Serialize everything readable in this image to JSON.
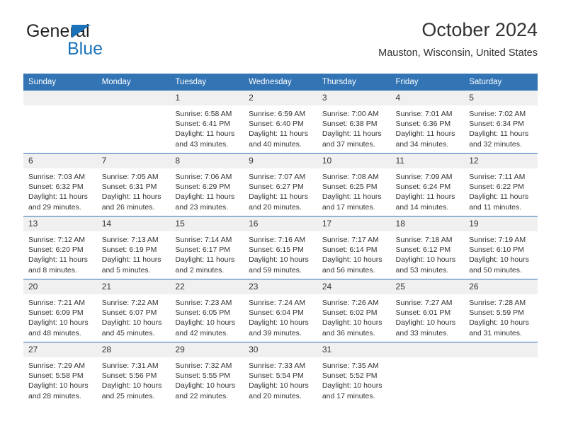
{
  "logo": {
    "word_one": "General",
    "word_two": "Blue",
    "triangle_icon": "triangle-icon",
    "brand_color": "#1b72b8",
    "text_color": "#231f20"
  },
  "header": {
    "title": "October 2024",
    "location": "Mauston, Wisconsin, United States"
  },
  "theme": {
    "header_blue": "#3274b4",
    "daynum_band": "#f0f0f0",
    "text": "#333333"
  },
  "calendar": {
    "weekday_headers": [
      "Sunday",
      "Monday",
      "Tuesday",
      "Wednesday",
      "Thursday",
      "Friday",
      "Saturday"
    ],
    "weeks": [
      [
        {
          "day": "",
          "lines": []
        },
        {
          "day": "",
          "lines": []
        },
        {
          "day": "1",
          "lines": [
            "Sunrise: 6:58 AM",
            "Sunset: 6:41 PM",
            "Daylight: 11 hours",
            "and 43 minutes."
          ]
        },
        {
          "day": "2",
          "lines": [
            "Sunrise: 6:59 AM",
            "Sunset: 6:40 PM",
            "Daylight: 11 hours",
            "and 40 minutes."
          ]
        },
        {
          "day": "3",
          "lines": [
            "Sunrise: 7:00 AM",
            "Sunset: 6:38 PM",
            "Daylight: 11 hours",
            "and 37 minutes."
          ]
        },
        {
          "day": "4",
          "lines": [
            "Sunrise: 7:01 AM",
            "Sunset: 6:36 PM",
            "Daylight: 11 hours",
            "and 34 minutes."
          ]
        },
        {
          "day": "5",
          "lines": [
            "Sunrise: 7:02 AM",
            "Sunset: 6:34 PM",
            "Daylight: 11 hours",
            "and 32 minutes."
          ]
        }
      ],
      [
        {
          "day": "6",
          "lines": [
            "Sunrise: 7:03 AM",
            "Sunset: 6:32 PM",
            "Daylight: 11 hours",
            "and 29 minutes."
          ]
        },
        {
          "day": "7",
          "lines": [
            "Sunrise: 7:05 AM",
            "Sunset: 6:31 PM",
            "Daylight: 11 hours",
            "and 26 minutes."
          ]
        },
        {
          "day": "8",
          "lines": [
            "Sunrise: 7:06 AM",
            "Sunset: 6:29 PM",
            "Daylight: 11 hours",
            "and 23 minutes."
          ]
        },
        {
          "day": "9",
          "lines": [
            "Sunrise: 7:07 AM",
            "Sunset: 6:27 PM",
            "Daylight: 11 hours",
            "and 20 minutes."
          ]
        },
        {
          "day": "10",
          "lines": [
            "Sunrise: 7:08 AM",
            "Sunset: 6:25 PM",
            "Daylight: 11 hours",
            "and 17 minutes."
          ]
        },
        {
          "day": "11",
          "lines": [
            "Sunrise: 7:09 AM",
            "Sunset: 6:24 PM",
            "Daylight: 11 hours",
            "and 14 minutes."
          ]
        },
        {
          "day": "12",
          "lines": [
            "Sunrise: 7:11 AM",
            "Sunset: 6:22 PM",
            "Daylight: 11 hours",
            "and 11 minutes."
          ]
        }
      ],
      [
        {
          "day": "13",
          "lines": [
            "Sunrise: 7:12 AM",
            "Sunset: 6:20 PM",
            "Daylight: 11 hours",
            "and 8 minutes."
          ]
        },
        {
          "day": "14",
          "lines": [
            "Sunrise: 7:13 AM",
            "Sunset: 6:19 PM",
            "Daylight: 11 hours",
            "and 5 minutes."
          ]
        },
        {
          "day": "15",
          "lines": [
            "Sunrise: 7:14 AM",
            "Sunset: 6:17 PM",
            "Daylight: 11 hours",
            "and 2 minutes."
          ]
        },
        {
          "day": "16",
          "lines": [
            "Sunrise: 7:16 AM",
            "Sunset: 6:15 PM",
            "Daylight: 10 hours",
            "and 59 minutes."
          ]
        },
        {
          "day": "17",
          "lines": [
            "Sunrise: 7:17 AM",
            "Sunset: 6:14 PM",
            "Daylight: 10 hours",
            "and 56 minutes."
          ]
        },
        {
          "day": "18",
          "lines": [
            "Sunrise: 7:18 AM",
            "Sunset: 6:12 PM",
            "Daylight: 10 hours",
            "and 53 minutes."
          ]
        },
        {
          "day": "19",
          "lines": [
            "Sunrise: 7:19 AM",
            "Sunset: 6:10 PM",
            "Daylight: 10 hours",
            "and 50 minutes."
          ]
        }
      ],
      [
        {
          "day": "20",
          "lines": [
            "Sunrise: 7:21 AM",
            "Sunset: 6:09 PM",
            "Daylight: 10 hours",
            "and 48 minutes."
          ]
        },
        {
          "day": "21",
          "lines": [
            "Sunrise: 7:22 AM",
            "Sunset: 6:07 PM",
            "Daylight: 10 hours",
            "and 45 minutes."
          ]
        },
        {
          "day": "22",
          "lines": [
            "Sunrise: 7:23 AM",
            "Sunset: 6:05 PM",
            "Daylight: 10 hours",
            "and 42 minutes."
          ]
        },
        {
          "day": "23",
          "lines": [
            "Sunrise: 7:24 AM",
            "Sunset: 6:04 PM",
            "Daylight: 10 hours",
            "and 39 minutes."
          ]
        },
        {
          "day": "24",
          "lines": [
            "Sunrise: 7:26 AM",
            "Sunset: 6:02 PM",
            "Daylight: 10 hours",
            "and 36 minutes."
          ]
        },
        {
          "day": "25",
          "lines": [
            "Sunrise: 7:27 AM",
            "Sunset: 6:01 PM",
            "Daylight: 10 hours",
            "and 33 minutes."
          ]
        },
        {
          "day": "26",
          "lines": [
            "Sunrise: 7:28 AM",
            "Sunset: 5:59 PM",
            "Daylight: 10 hours",
            "and 31 minutes."
          ]
        }
      ],
      [
        {
          "day": "27",
          "lines": [
            "Sunrise: 7:29 AM",
            "Sunset: 5:58 PM",
            "Daylight: 10 hours",
            "and 28 minutes."
          ]
        },
        {
          "day": "28",
          "lines": [
            "Sunrise: 7:31 AM",
            "Sunset: 5:56 PM",
            "Daylight: 10 hours",
            "and 25 minutes."
          ]
        },
        {
          "day": "29",
          "lines": [
            "Sunrise: 7:32 AM",
            "Sunset: 5:55 PM",
            "Daylight: 10 hours",
            "and 22 minutes."
          ]
        },
        {
          "day": "30",
          "lines": [
            "Sunrise: 7:33 AM",
            "Sunset: 5:54 PM",
            "Daylight: 10 hours",
            "and 20 minutes."
          ]
        },
        {
          "day": "31",
          "lines": [
            "Sunrise: 7:35 AM",
            "Sunset: 5:52 PM",
            "Daylight: 10 hours",
            "and 17 minutes."
          ]
        },
        {
          "day": "",
          "lines": []
        },
        {
          "day": "",
          "lines": []
        }
      ]
    ]
  }
}
